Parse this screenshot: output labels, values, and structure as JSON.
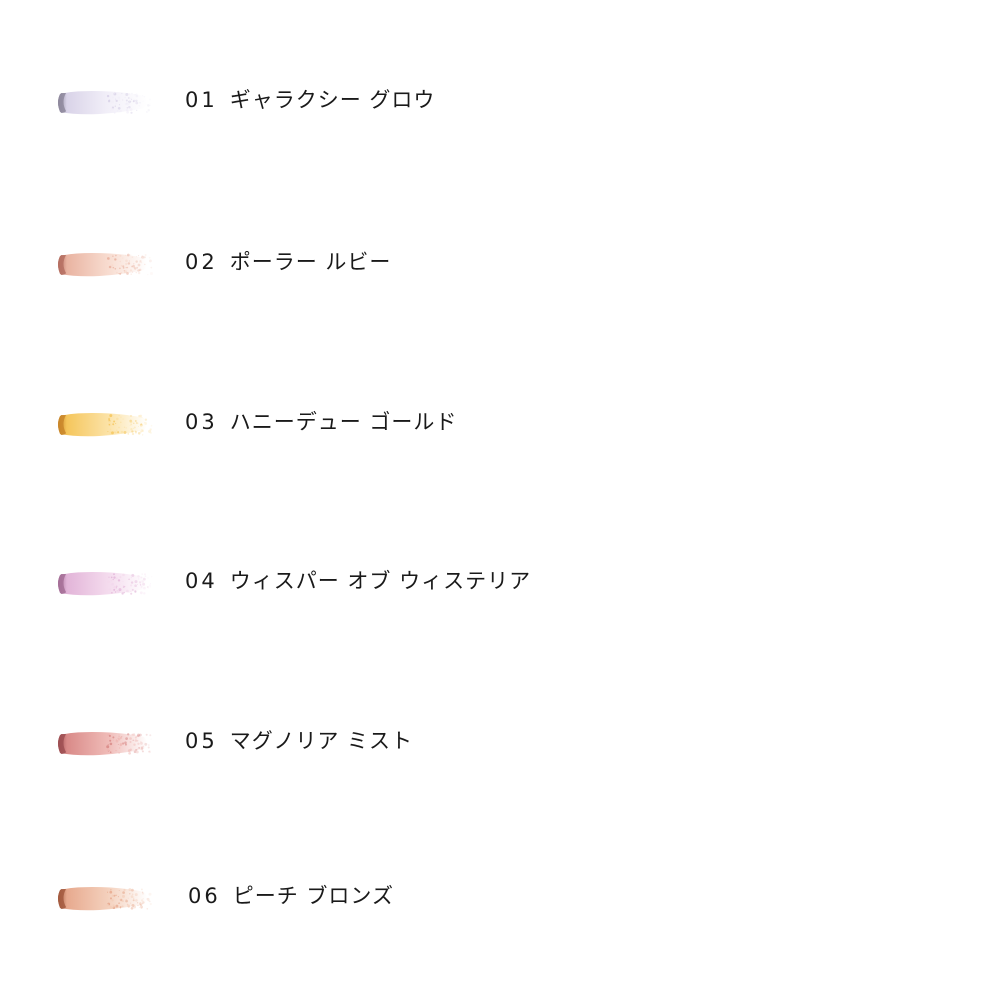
{
  "shades": [
    {
      "number": "01",
      "name": "ギャラクシー グロウ",
      "color": "#d9d3e8",
      "edge": "#8e889c",
      "highlight": "#f1eef8"
    },
    {
      "number": "02",
      "name": "ポーラー ルビー",
      "color": "#e9b3a1",
      "edge": "#b56f62",
      "highlight": "#f7d9cc"
    },
    {
      "number": "03",
      "name": "ハニーデュー ゴールド",
      "color": "#f5c65c",
      "edge": "#c9862a",
      "highlight": "#fbe0a0"
    },
    {
      "number": "04",
      "name": "ウィスパー オブ ウィステリア",
      "color": "#e2b4d8",
      "edge": "#a56f97",
      "highlight": "#f3d8ec"
    },
    {
      "number": "05",
      "name": "マグノリア ミスト",
      "color": "#d98a88",
      "edge": "#9e4f52",
      "highlight": "#eeb6b2"
    },
    {
      "number": "06",
      "name": "ピーチ ブロンズ",
      "color": "#e7a98e",
      "edge": "#a35b3f",
      "highlight": "#f3cdb8"
    }
  ]
}
